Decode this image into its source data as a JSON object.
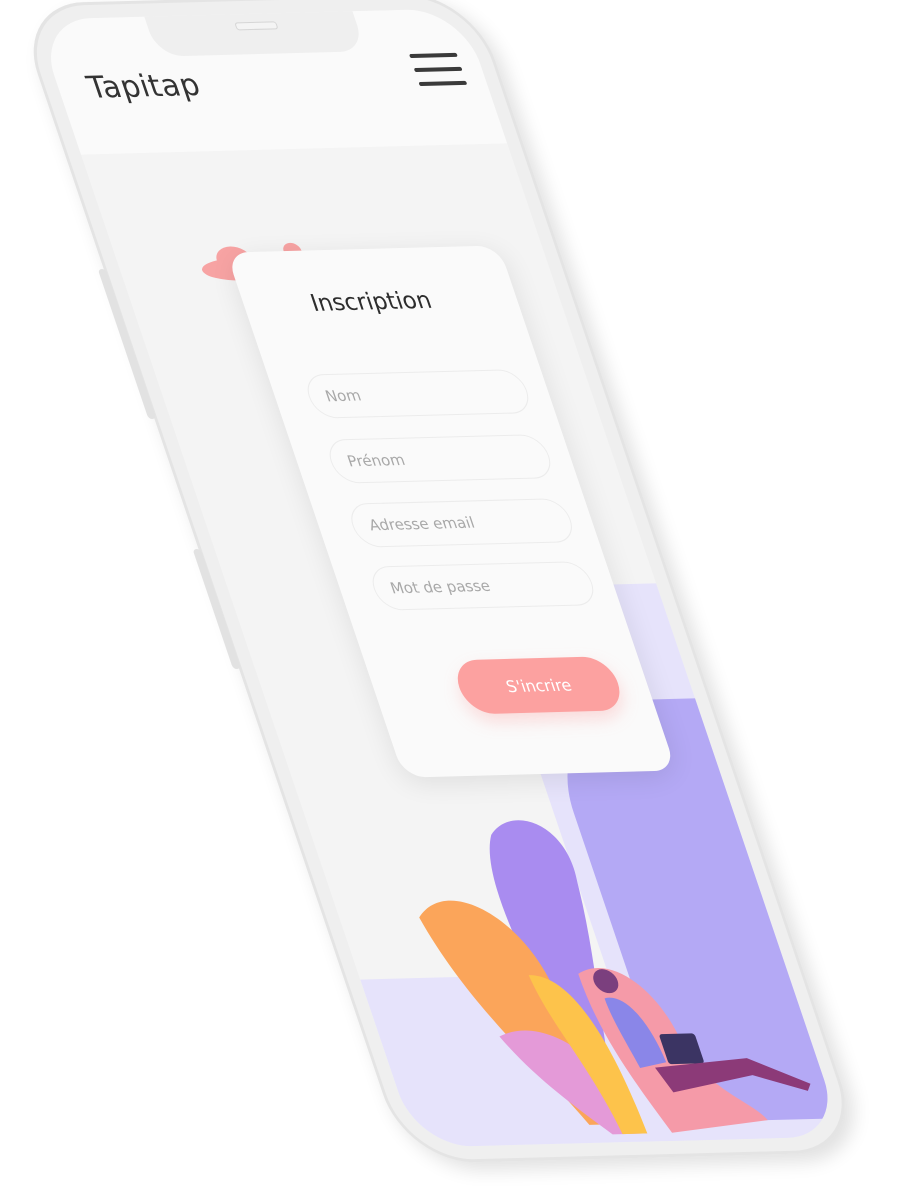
{
  "app": {
    "title": "Tapitap",
    "menu_icon": "hamburger-icon"
  },
  "form": {
    "title": "Inscription",
    "fields": [
      {
        "placeholder": "Nom",
        "value": ""
      },
      {
        "placeholder": "Prénom",
        "value": ""
      },
      {
        "placeholder": "Adresse email",
        "value": ""
      },
      {
        "placeholder": "Mot de passe",
        "value": ""
      }
    ],
    "submit_label": "S'incrire"
  },
  "colors": {
    "accent": "#fca1a0",
    "lavender": "#b4a9f5",
    "lavender_light": "#e6e3fb",
    "background": "#f4f4f4"
  }
}
